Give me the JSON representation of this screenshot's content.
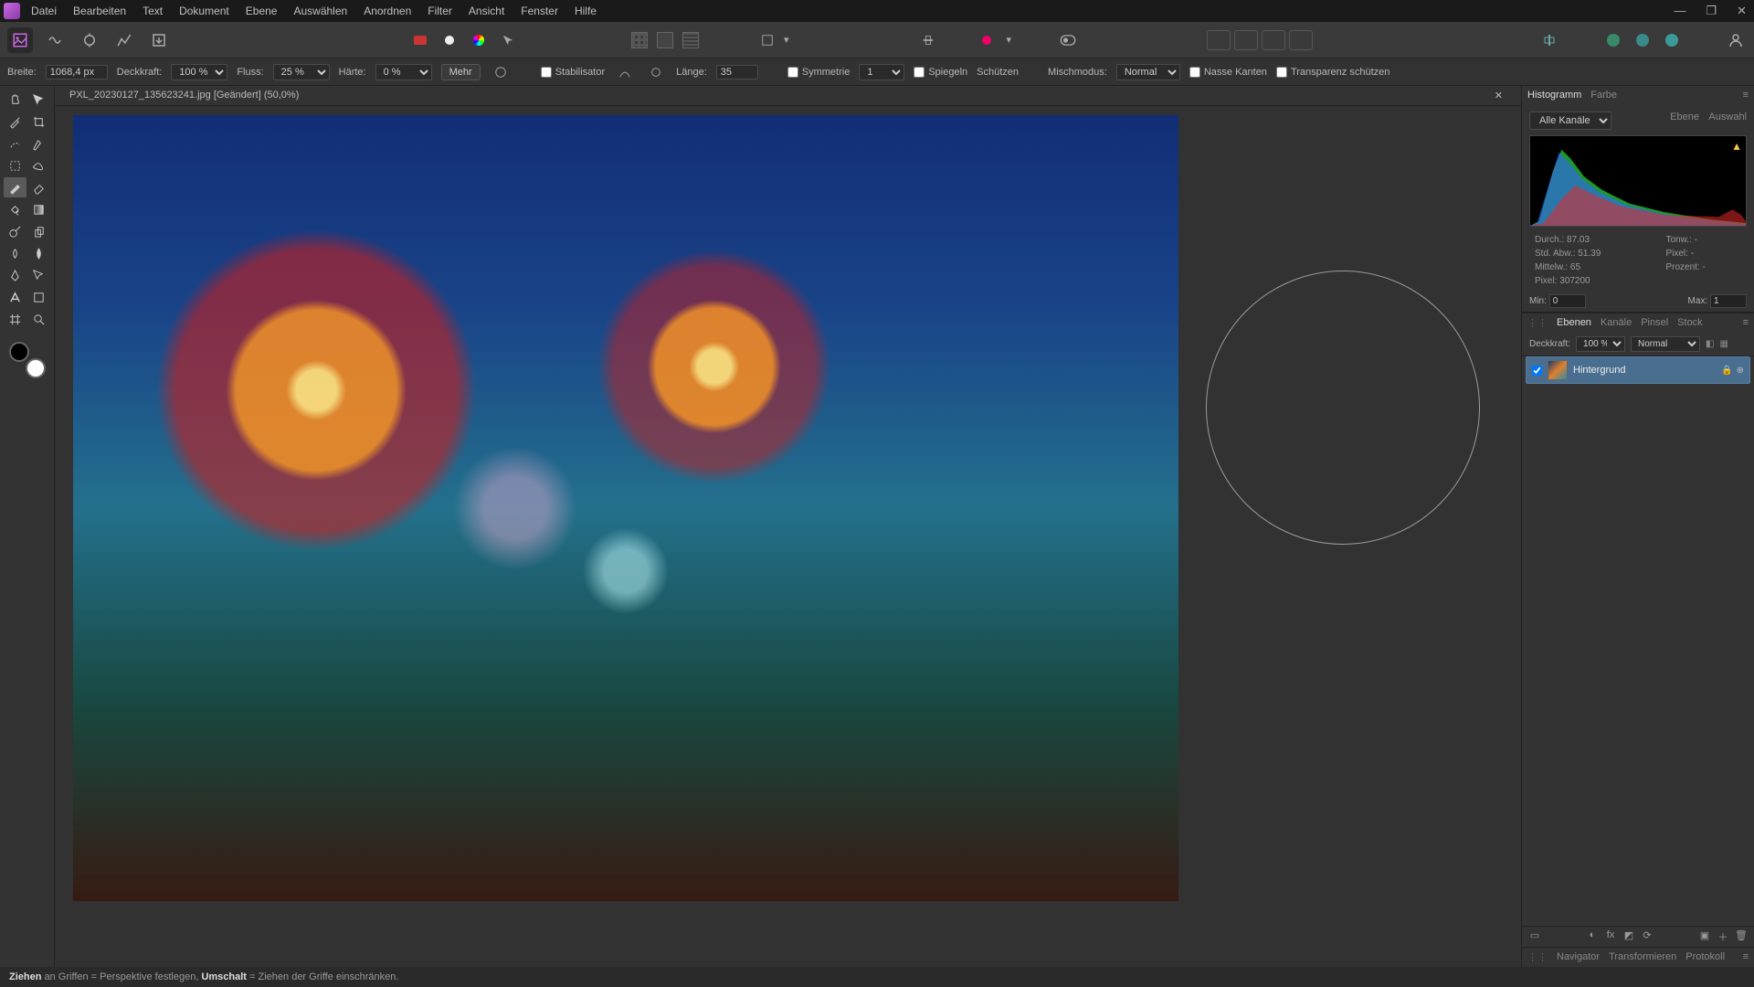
{
  "menu": [
    "Datei",
    "Bearbeiten",
    "Text",
    "Dokument",
    "Ebene",
    "Auswählen",
    "Anordnen",
    "Filter",
    "Ansicht",
    "Fenster",
    "Hilfe"
  ],
  "document": {
    "tab_label": "PXL_20230127_135623241.jpg [Geändert] (50,0%)"
  },
  "context_toolbar": {
    "width_label": "Breite:",
    "width_value": "1068,4 px",
    "opacity_label": "Deckkraft:",
    "opacity_value": "100 %",
    "flow_label": "Fluss:",
    "flow_value": "25 %",
    "hardness_label": "Härte:",
    "hardness_value": "0 %",
    "more_label": "Mehr",
    "stabilizer_label": "Stabilisator",
    "length_label": "Länge:",
    "length_value": "35",
    "symmetry_label": "Symmetrie",
    "symmetry_value": "1",
    "mirror_label": "Spiegeln",
    "protect_label": "Schützen",
    "blendmode_label": "Mischmodus:",
    "blendmode_value": "Normal",
    "wet_edges_label": "Nasse Kanten",
    "protect_alpha_label": "Transparenz schützen"
  },
  "right_panel": {
    "histogram_tab": "Histogramm",
    "color_tab": "Farbe",
    "channel_dropdown": "Alle Kanäle",
    "layer_btn": "Ebene",
    "selection_btn": "Auswahl",
    "stats": {
      "avg_label": "Durch.:",
      "avg_value": "87.03",
      "stddev_label": "Std. Abw.:",
      "stddev_value": "51.39",
      "median_label": "Mittelw.:",
      "median_value": "65",
      "pixels_label": "Pixel:",
      "pixels_value": "307200",
      "tone_label": "Tonw.:",
      "tone_value": "-",
      "pixel2_label": "Pixel:",
      "pixel2_value": "-",
      "percent_label": "Prozent:",
      "percent_value": "-"
    },
    "min_label": "Min:",
    "min_value": "0",
    "max_label": "Max:",
    "max_value": "1"
  },
  "layers_panel": {
    "tabs": [
      "Ebenen",
      "Kanäle",
      "Pinsel",
      "Stock"
    ],
    "opacity_label": "Deckkraft:",
    "opacity_value": "100 %",
    "blend_value": "Normal",
    "layer_name": "Hintergrund"
  },
  "bottom_tabs": [
    "Navigator",
    "Transformieren",
    "Protokoll"
  ],
  "status": {
    "bold1": "Ziehen",
    "text1": " an Griffen = Perspektive festlegen, ",
    "bold2": "Umschalt",
    "text2": " = Ziehen der Griffe einschränken."
  }
}
